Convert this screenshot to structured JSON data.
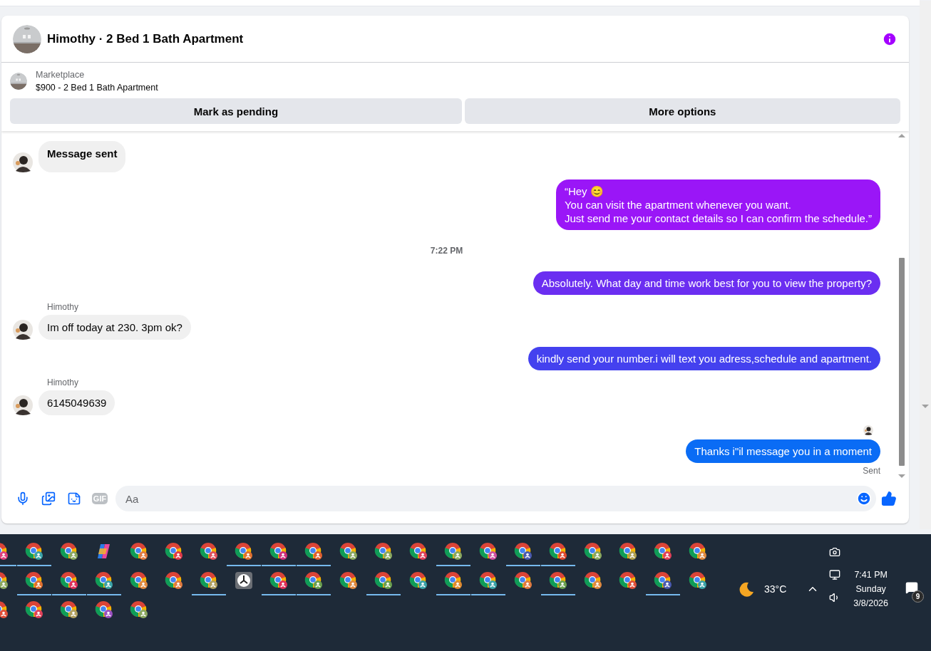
{
  "conversation": {
    "title": "Himothy · 2 Bed 1 Bath Apartment",
    "listing": {
      "source": "Marketplace",
      "summary": "$900 - 2 Bed 1 Bath Apartment"
    },
    "actions": [
      "Mark as pending",
      "More options"
    ]
  },
  "messages": [
    {
      "kind": "incoming",
      "text": "Message sent",
      "bold": true
    },
    {
      "kind": "outgoing",
      "text": "“Hey 😊\nYou can visit the apartment whenever you want.\nJust send me your contact details so I can confirm the schedule.”",
      "color": "#9a16f7"
    },
    {
      "kind": "timestamp",
      "text": "7:22 PM"
    },
    {
      "kind": "outgoing",
      "text": "Absolutely. What day and time work best for you to view the property?",
      "color": "#6b2ef1"
    },
    {
      "kind": "incoming",
      "sender": "Himothy",
      "text": "Im off today at 230. 3pm ok?",
      "bold": false
    },
    {
      "kind": "outgoing",
      "text": "kindly send your number.i will text you adress,schedule and apartment.",
      "color": "#4441ef"
    },
    {
      "kind": "incoming",
      "sender": "Himothy",
      "text": "6145049639",
      "bold": false
    },
    {
      "kind": "seen"
    },
    {
      "kind": "outgoing",
      "text": "Thanks i\"il message you in a moment",
      "color": "#0a6cf5",
      "status": "Sent"
    }
  ],
  "composer": {
    "gif_label": "GIF",
    "placeholder": "Aa"
  },
  "taskbar": {
    "rows": [
      [
        {
          "kind": "chrome",
          "running": true,
          "color": "#e0407a"
        },
        {
          "kind": "chrome",
          "running": true,
          "color": "#3aa3a8"
        },
        {
          "kind": "chrome",
          "running": false,
          "color": "#8aa860"
        },
        {
          "kind": "copilot",
          "running": false
        },
        {
          "kind": "chrome",
          "running": false,
          "color": "#e07a40"
        },
        {
          "kind": "chrome",
          "running": false,
          "color": "#e03a4a"
        },
        {
          "kind": "chrome",
          "running": false,
          "color": "#e0505a"
        },
        {
          "kind": "chrome",
          "running": true,
          "color": "#e07030"
        },
        {
          "kind": "chrome",
          "running": true,
          "color": "#d0307a"
        },
        {
          "kind": "chrome",
          "running": true,
          "color": "#e06030"
        },
        {
          "kind": "chrome",
          "running": false,
          "color": "#8aa860"
        },
        {
          "kind": "chrome",
          "running": false,
          "color": "#8aa860"
        },
        {
          "kind": "chrome",
          "running": false,
          "color": "#e0405a"
        },
        {
          "kind": "chrome",
          "running": true,
          "color": "#8aa860"
        },
        {
          "kind": "chrome",
          "running": false,
          "color": "#d050a0"
        },
        {
          "kind": "chrome",
          "running": true,
          "color": "#4a5ab0"
        },
        {
          "kind": "chrome",
          "running": true,
          "color": "#e04a30"
        },
        {
          "kind": "chrome",
          "running": false,
          "color": "#8aa860"
        },
        {
          "kind": "chrome",
          "running": false,
          "color": "#b0a050"
        },
        {
          "kind": "chrome",
          "running": false,
          "color": "#e0405a"
        },
        {
          "kind": "chrome",
          "running": false,
          "color": "#e08a40"
        }
      ],
      [
        {
          "kind": "chrome",
          "running": false,
          "color": "#8aa860"
        },
        {
          "kind": "chrome",
          "running": true,
          "color": "#e07030"
        },
        {
          "kind": "chrome",
          "running": true,
          "color": "#e0305a"
        },
        {
          "kind": "chrome",
          "running": true,
          "color": "#3aa3a8"
        },
        {
          "kind": "chrome",
          "running": false,
          "color": "#e08a40"
        },
        {
          "kind": "chrome",
          "running": false,
          "color": "#e07a40"
        },
        {
          "kind": "chrome",
          "running": true,
          "color": "#b0a060"
        },
        {
          "kind": "clock",
          "running": false
        },
        {
          "kind": "chrome",
          "running": true,
          "color": "#e0305a"
        },
        {
          "kind": "chrome",
          "running": true,
          "color": "#6aa050"
        },
        {
          "kind": "chrome",
          "running": false,
          "color": "#e08a40"
        },
        {
          "kind": "chrome",
          "running": true,
          "color": "#6aa050"
        },
        {
          "kind": "chrome",
          "running": false,
          "color": "#3aa3a8"
        },
        {
          "kind": "chrome",
          "running": true,
          "color": "#e08a30"
        },
        {
          "kind": "chrome",
          "running": true,
          "color": "#3aa3a8"
        },
        {
          "kind": "chrome",
          "running": false,
          "color": "#e07a40"
        },
        {
          "kind": "chrome",
          "running": true,
          "color": "#6aa050"
        },
        {
          "kind": "chrome",
          "running": false,
          "color": "#e08a40"
        },
        {
          "kind": "chrome",
          "running": false,
          "color": "#e0503a"
        },
        {
          "kind": "chrome",
          "running": true,
          "color": "#4a5ab0"
        },
        {
          "kind": "chrome",
          "running": false,
          "color": "#3aa3a8"
        }
      ],
      [
        {
          "kind": "chrome",
          "running": false,
          "color": "#e0503a"
        },
        {
          "kind": "chrome",
          "running": false,
          "color": "#e0405a"
        },
        {
          "kind": "chrome",
          "running": false,
          "color": "#b0a060"
        },
        {
          "kind": "chrome",
          "running": false,
          "color": "#9a50c0"
        },
        {
          "kind": "chrome",
          "running": false,
          "color": "#8aa860"
        }
      ]
    ],
    "weather": "33°C",
    "time": "7:41 PM",
    "day": "Sunday",
    "date": "3/8/2026",
    "notifications": "9"
  }
}
